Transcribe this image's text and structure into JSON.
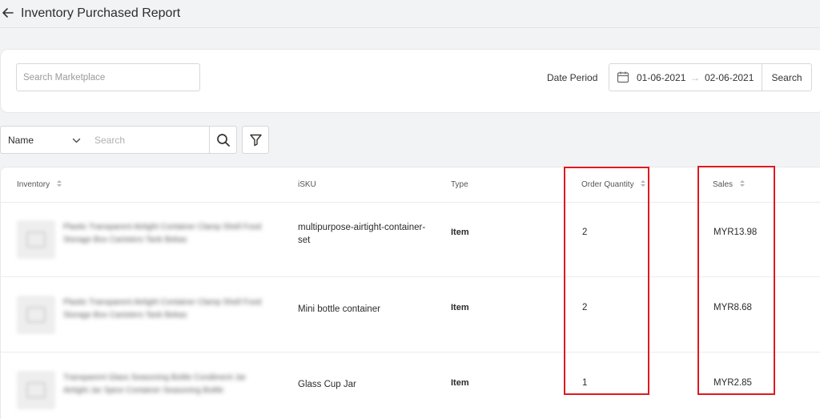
{
  "header": {
    "title": "Inventory Purchased Report",
    "back_icon": "arrow-left-icon"
  },
  "filters": {
    "marketplace_search": {
      "placeholder": "Search Marketplace",
      "value": ""
    },
    "date_period_label": "Date Period",
    "date_start": "01-06-2021",
    "date_separator": "→",
    "date_end": "02-06-2021",
    "search_button": "Search"
  },
  "toolbar": {
    "field_select": "Name",
    "search": {
      "placeholder": "Search",
      "value": ""
    }
  },
  "table": {
    "columns": [
      "Inventory",
      "iSKU",
      "Type",
      "Order Quantity",
      "Sales"
    ],
    "rows": [
      {
        "name": "Plastic Transparent Airtight Container Clamp Shell Food Storage Box Canisters Tank Bekas",
        "isku": "multipurpose-airtight-container-set",
        "type": "Item",
        "order_quantity": "2",
        "sales": "MYR13.98"
      },
      {
        "name": "Plastic Transparent Airtight Container Clamp Shell Food Storage Box Canisters Tank Bekas",
        "isku": "Mini bottle container",
        "type": "Item",
        "order_quantity": "2",
        "sales": "MYR8.68"
      },
      {
        "name": "Transparent Glass Seasoning Bottle Condiment Jar Airtight Jar Spice Container Seasoning Bottle",
        "isku": "Glass Cup Jar",
        "type": "Item",
        "order_quantity": "1",
        "sales": "MYR2.85"
      }
    ]
  },
  "colors": {
    "highlight": "#e0191e",
    "background": "#f2f3f5"
  }
}
